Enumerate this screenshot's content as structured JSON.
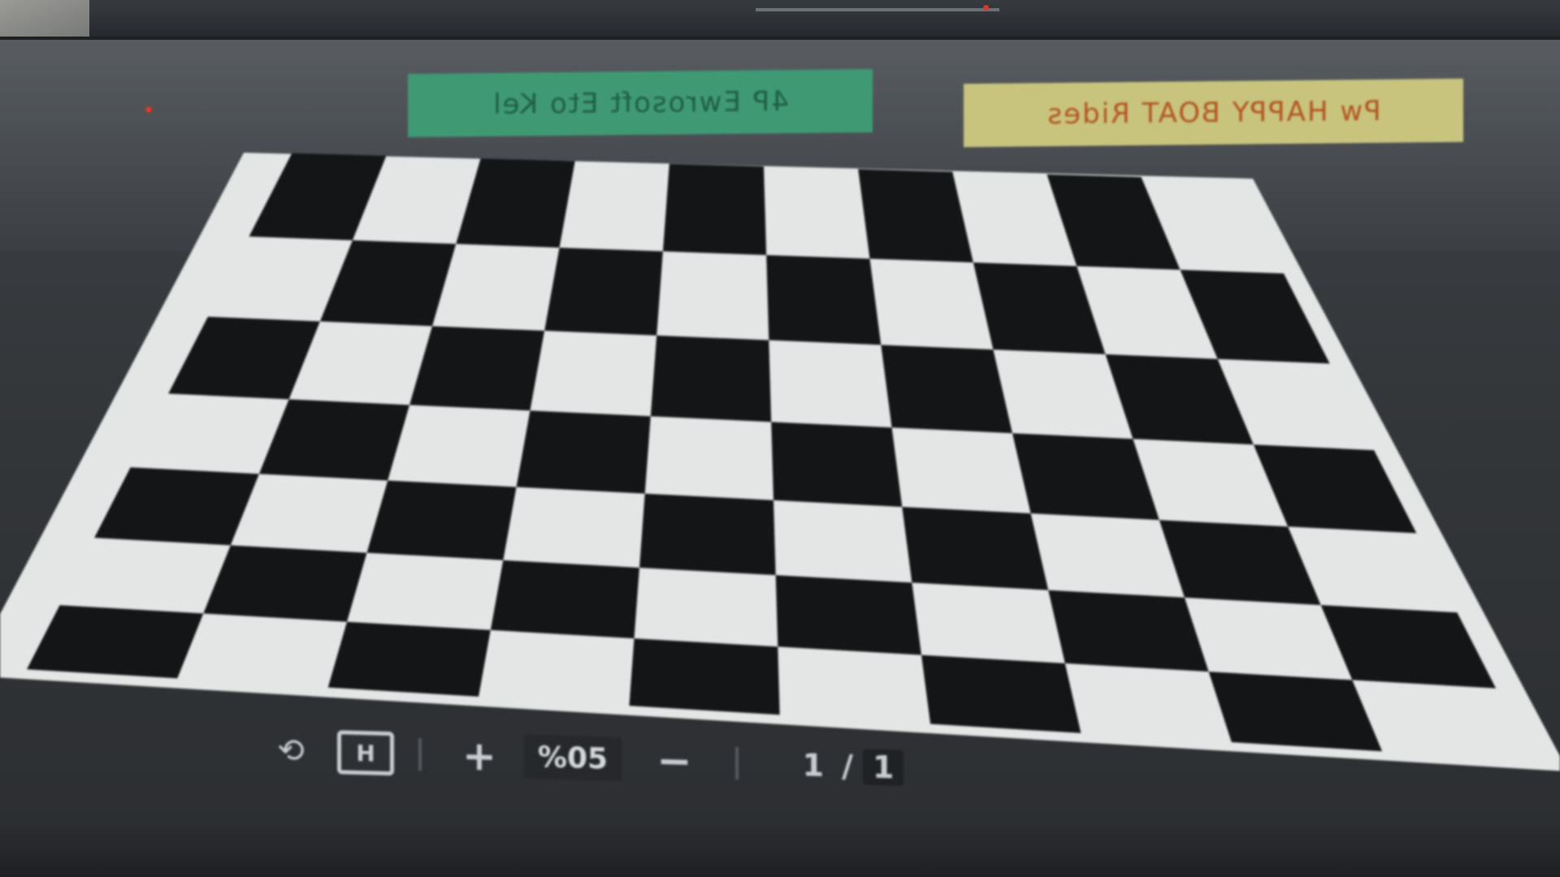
{
  "scene": {
    "description_tag": "",
    "colors": {
      "bezel": "#2f3134",
      "board_light": "#e4e6e6",
      "board_dark": "#141517",
      "note_green": "#3f9a74",
      "note_yellow": "#c8c47e"
    }
  },
  "reflections": {
    "green_note_text": "4P Ewrosoft Eto Kel",
    "yellow_note_text": "Pw HAPPY BOAT Rides"
  },
  "chessboard": {
    "rows": 7,
    "cols": 10
  },
  "toolbar": {
    "rotate_icon": "rotate-icon",
    "fit_icon": "fit-to-screen-icon",
    "fit_label": "H",
    "zoom_in_label": "+",
    "zoom_value": "%05",
    "zoom_out_label": "−",
    "page_current": "1",
    "page_separator": "/",
    "page_total": "1"
  }
}
